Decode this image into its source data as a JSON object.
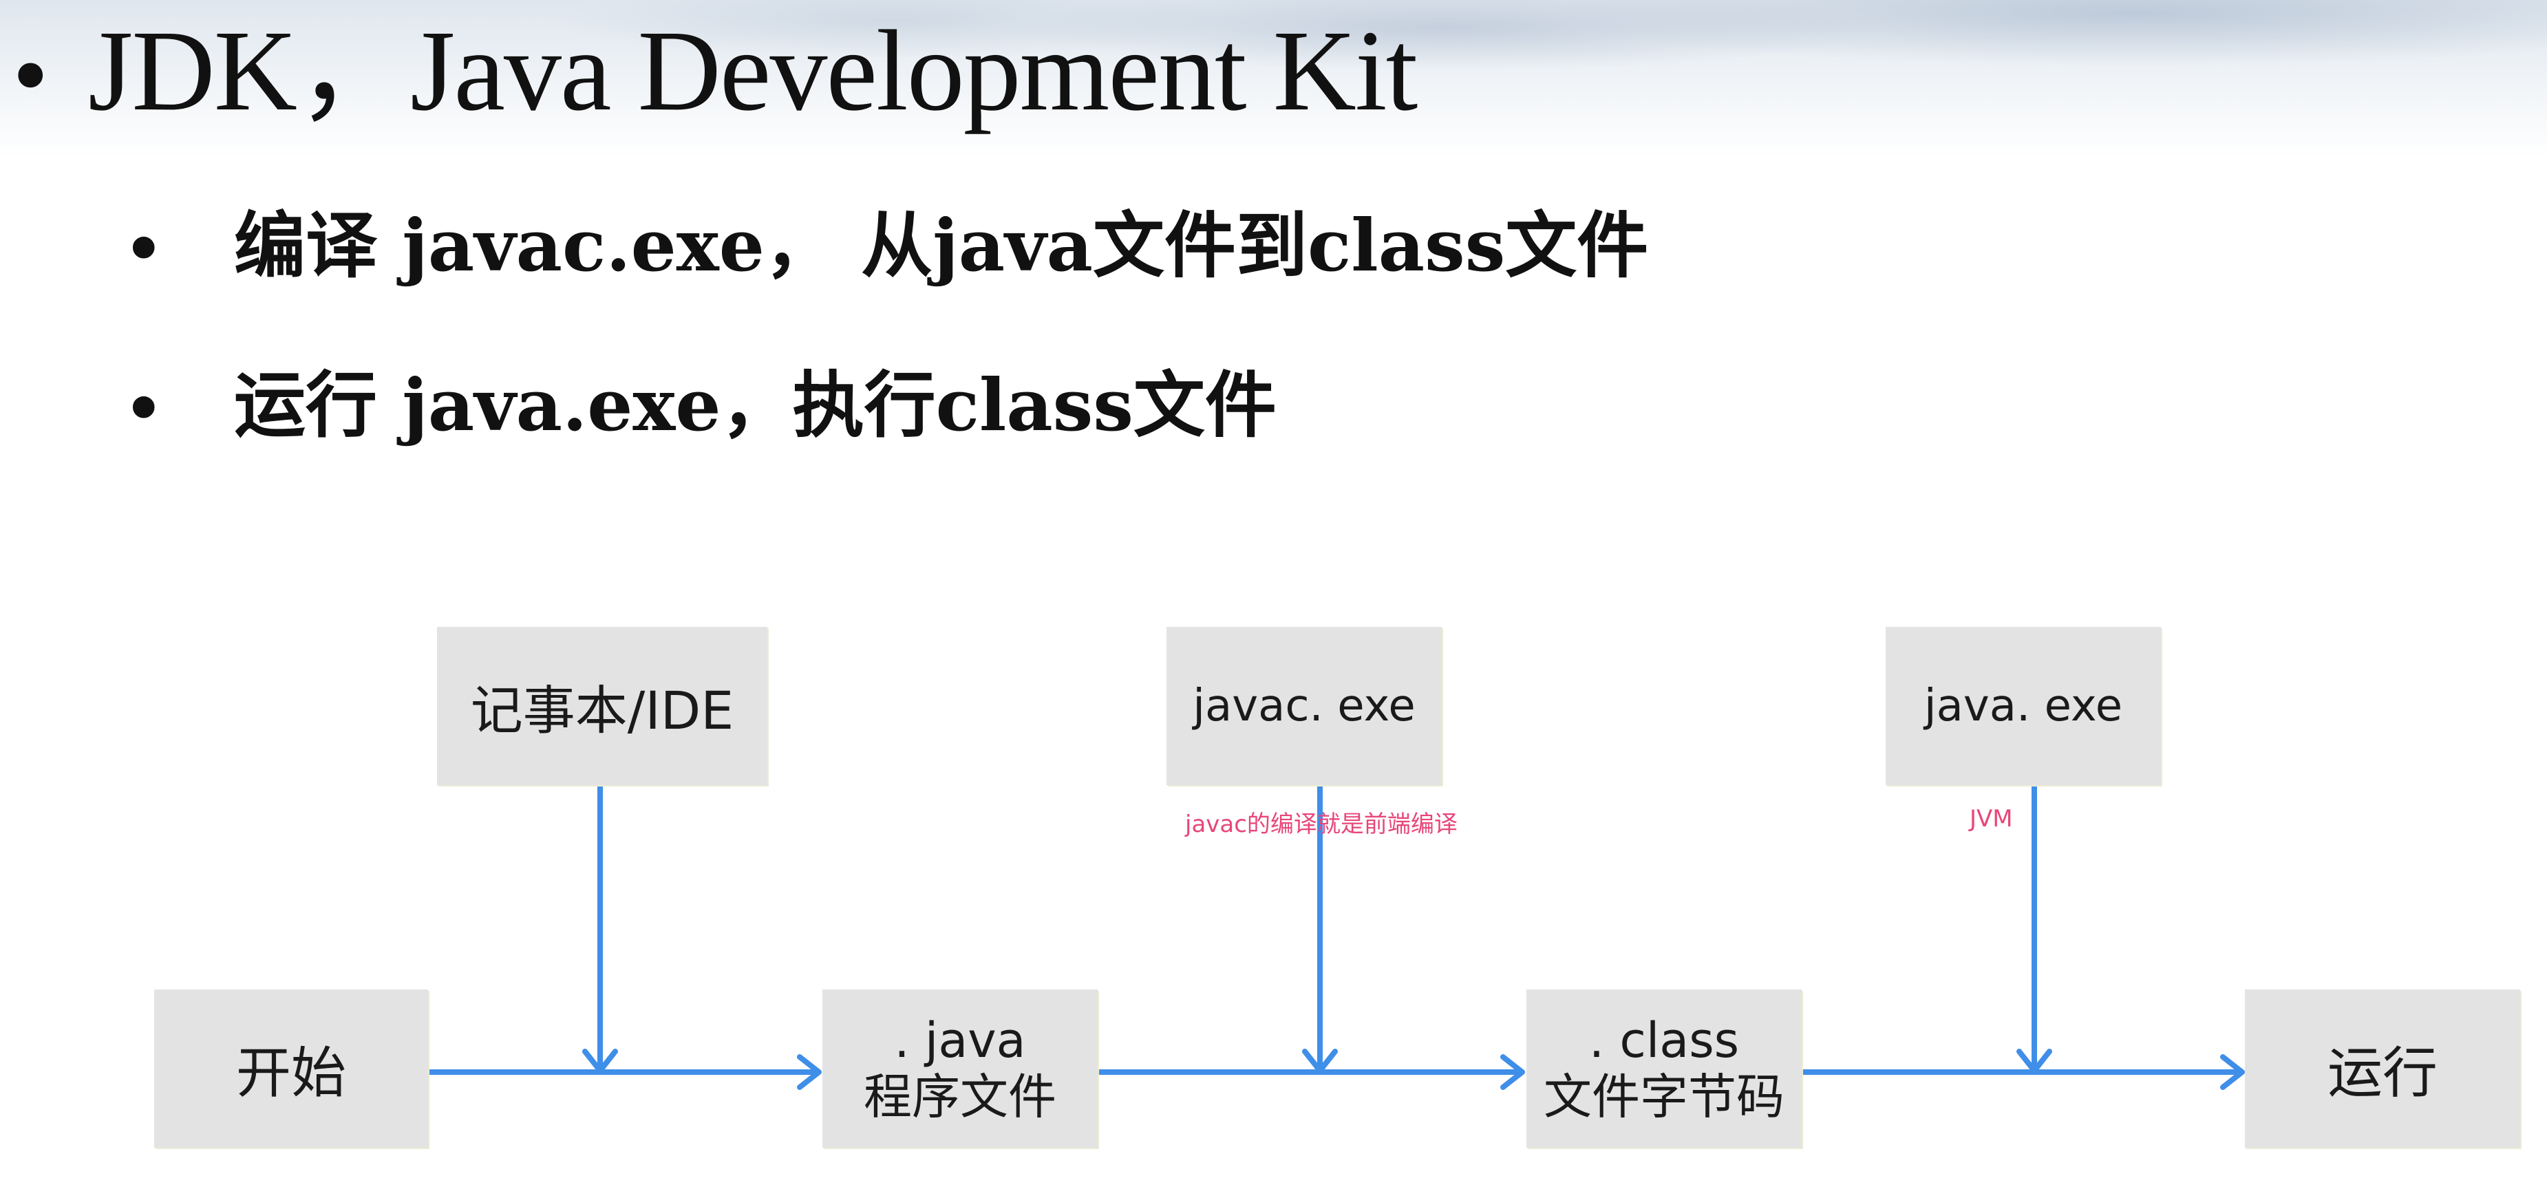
{
  "title": "JDK，Java Development Kit",
  "bullets": [
    "编译 javac.exe， 从java文件到class文件",
    "运行 java.exe，执行class文件"
  ],
  "bullet_symbol": "•",
  "diagram": {
    "boxes": {
      "start": "开始",
      "editor": "记事本/IDE",
      "java_file_ext": ". java",
      "java_file_desc": "程序文件",
      "javac": "javac. exe",
      "class_file_ext": ". class",
      "class_file_desc": "文件字节码",
      "java_exe": "java. exe",
      "run": "运行"
    },
    "annotations": {
      "javac_note": "javac的编译就是前端编译",
      "jvm_note": "JVM"
    },
    "colors": {
      "arrow": "#3f8ee8",
      "box_fill": "#e3e3e3",
      "annotation": "#e8467a"
    }
  }
}
